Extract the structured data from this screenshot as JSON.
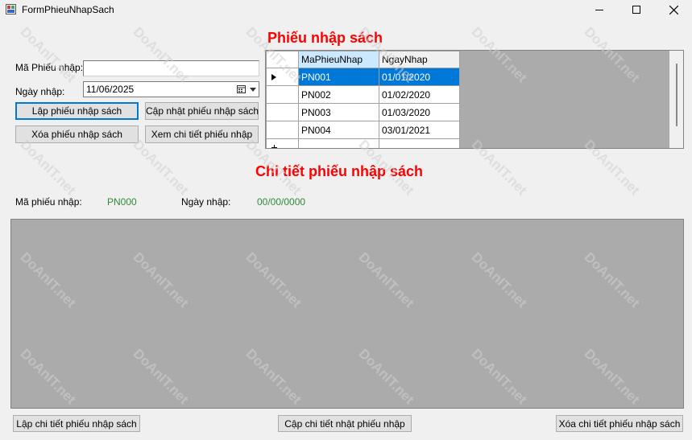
{
  "window": {
    "title": "FormPhieuNhapSach"
  },
  "form": {
    "ma_phieu_label": "Mã Phiếu nhập:",
    "ma_phieu_value": "",
    "ngay_nhap_label": "Ngày nhập:",
    "ngay_nhap_value": "11/06/2025",
    "btn_lap": "Lập phiếu nhập sách",
    "btn_capnhat": "Cập nhật phiếu nhập sách",
    "btn_xoa": "Xóa phiếu nhập sách",
    "btn_xem": "Xem chi tiết phiếu nhập"
  },
  "grid": {
    "heading": "Phiếu nhập sách",
    "columns": [
      "MaPhieuNhap",
      "NgayNhap"
    ],
    "rows": [
      [
        "PN001",
        "01/01/2020"
      ],
      [
        "PN002",
        "01/02/2020"
      ],
      [
        "PN003",
        "01/03/2020"
      ],
      [
        "PN004",
        "03/01/2021"
      ]
    ]
  },
  "detail": {
    "heading": "Chi tiết phiếu nhập sách",
    "ma_phieu_label": "Mã phiếu nhập:",
    "ma_phieu_value": "PN000",
    "ngay_nhap_label": "Ngày nhập:",
    "ngay_nhap_value": "00/00/0000",
    "btn_lap": "Lập chi tiết phiếu nhập sách",
    "btn_capnhat": "Cập chi tiết nhật phiếu nhập",
    "btn_xoa": "Xóa chi tiết phiếu nhập sách"
  },
  "watermark": "DoAnIT.net",
  "colors": {
    "heading": "#ff0000",
    "detail_value": "#2e8b3a",
    "selection": "#0078d7",
    "panel": "#ababab"
  }
}
